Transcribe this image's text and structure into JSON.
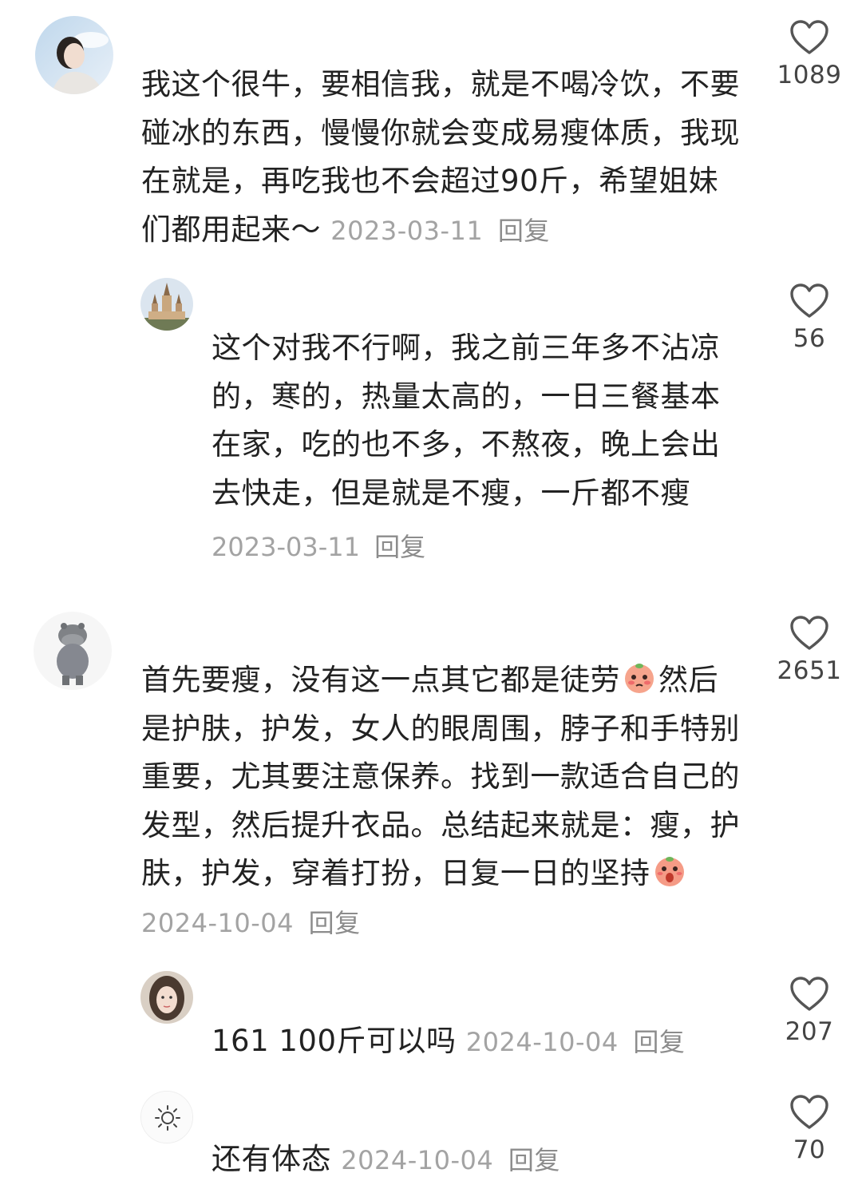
{
  "comments": [
    {
      "username": "",
      "text": "我这个很牛，要相信我，就是不喝冷饮，不要碰冰的东西，慢慢你就会变成易瘦体质，我现在就是，再吃我也不会超过90斤，希望姐妹们都用起来～",
      "date": "2023-03-11",
      "reply": "回复",
      "likes": "1089",
      "avatar_icon": "portrait-avatar",
      "replies": [
        {
          "text": "这个对我不行啊，我之前三年多不沾凉的，寒的，热量太高的，一日三餐基本在家，吃的也不多，不熬夜，晚上会出去快走，但是就是不瘦，一斤都不瘦",
          "date": "2023-03-11",
          "reply": "回复",
          "likes": "56",
          "avatar_icon": "castle-avatar"
        }
      ]
    },
    {
      "text_part1": "首先要瘦，没有这一点其它都是徒劳",
      "text_part2": "然后是护肤，护发，女人的眼周围，脖子和手特别重要，尤其要注意保养。找到一款适合自己的发型，然后提升衣品。总结起来就是：瘦，护肤，护发，穿着打扮，日复一日的坚持",
      "date": "2024-10-04",
      "reply": "回复",
      "likes": "2651",
      "avatar_icon": "hippo-avatar",
      "emoji_1": "peach-blush-emoji",
      "emoji_2": "peach-shock-emoji",
      "replies": [
        {
          "text": "161 100斤可以吗",
          "date": "2024-10-04",
          "reply": "回复",
          "likes": "207",
          "avatar_icon": "girl-avatar"
        },
        {
          "text": "还有体态",
          "date": "2024-10-04",
          "reply": "回复",
          "likes": "70",
          "avatar_icon": "sun-avatar"
        }
      ]
    }
  ],
  "colors": {
    "text": "#222222",
    "meta": "#a3a3a3",
    "heart_outline": "#555555"
  }
}
